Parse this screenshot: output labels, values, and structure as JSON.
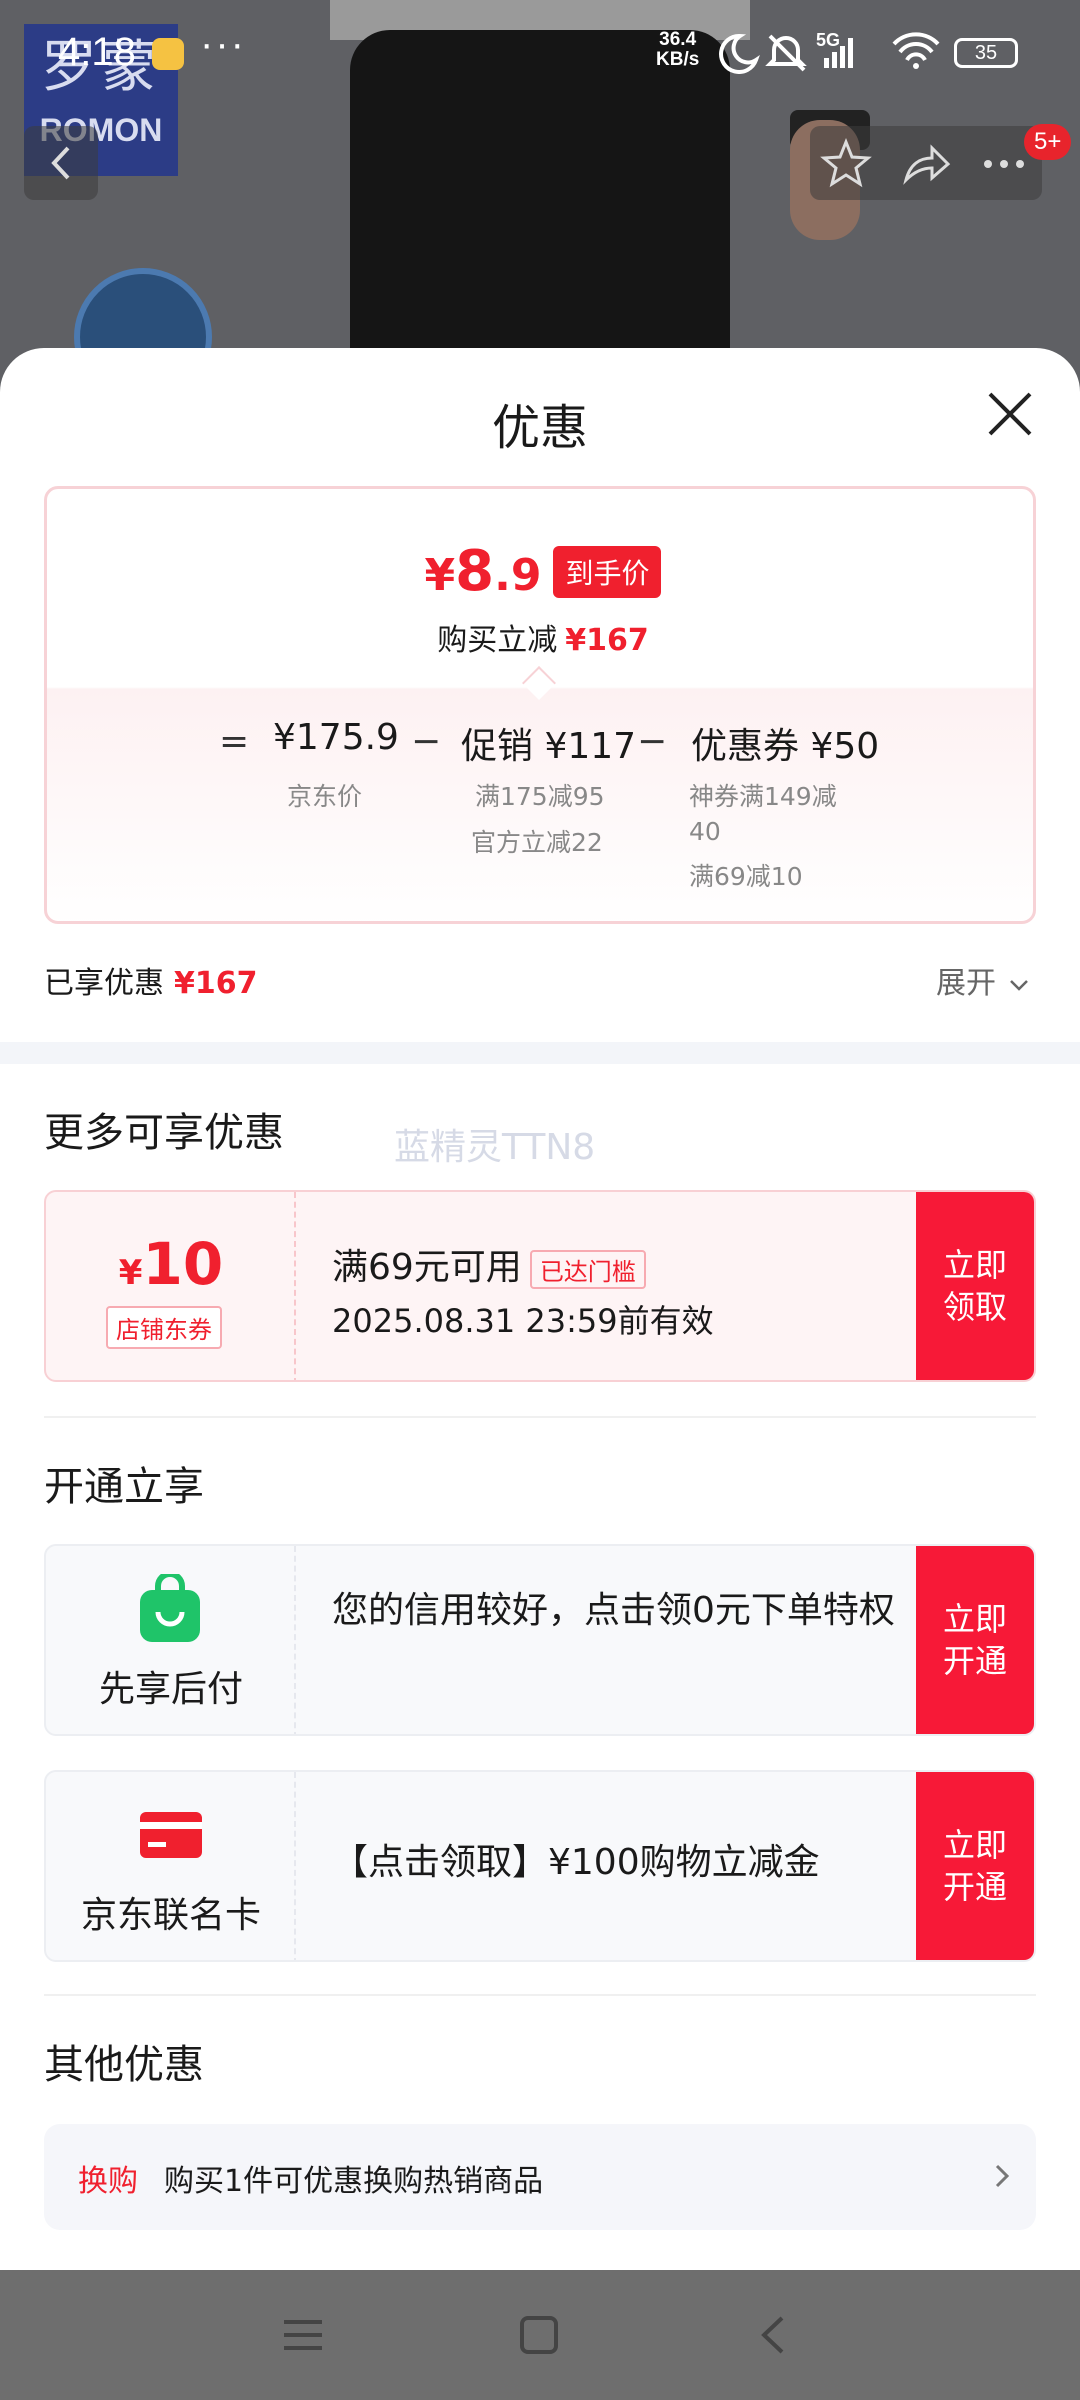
{
  "status_bar": {
    "time": "4:18",
    "more": "···",
    "net_speed_value": "36.4",
    "net_speed_unit": "KB/s",
    "signal_label": "5G",
    "battery": "35"
  },
  "background": {
    "brand_cn": "罗蒙",
    "brand_en": "ROMON",
    "message_badge": "5+"
  },
  "sheet": {
    "title": "优惠",
    "price_card": {
      "currency": "¥",
      "final_int": "8",
      "final_dec": ".9",
      "final_tag": "到手价",
      "reduce_label": "购买立减",
      "reduce_amount": "¥167",
      "equals": "=",
      "minus": "−",
      "columns": [
        {
          "main": "¥175.9",
          "subs": [
            "京东价"
          ]
        },
        {
          "main": "促销 ¥117",
          "subs": [
            "满175减95",
            "官方立减22"
          ]
        },
        {
          "main": "优惠券 ¥50",
          "subs": [
            "神券满149减",
            "40",
            "满69减10"
          ]
        }
      ]
    },
    "enjoyed": {
      "label": "已享优惠",
      "amount": "¥167",
      "expand": "展开"
    },
    "more_section": {
      "title": "更多可享优惠",
      "watermark": "蓝精灵TTN8",
      "coupon": {
        "symbol": "¥",
        "value": "10",
        "type": "店铺东券",
        "condition": "满69元可用",
        "reached": "已达门槛",
        "valid_until": "2025.08.31 23:59前有效",
        "button": "立即领取"
      }
    },
    "open_section": {
      "title": "开通立享",
      "items": [
        {
          "label": "先享后付",
          "desc": "您的信用较好，点击领0元下单特权",
          "button": "立即开通",
          "icon": "shopping-bag-icon"
        },
        {
          "label": "京东联名卡",
          "desc": "【点击领取】¥100购物立减金",
          "button": "立即开通",
          "icon": "credit-card-icon"
        }
      ]
    },
    "other_section": {
      "title": "其他优惠",
      "item": {
        "tag": "换购",
        "text": "购买1件可优惠换购热销商品"
      }
    }
  },
  "colors": {
    "accent": "#f0202e",
    "button": "#f71937",
    "pay_green": "#1fc469"
  }
}
